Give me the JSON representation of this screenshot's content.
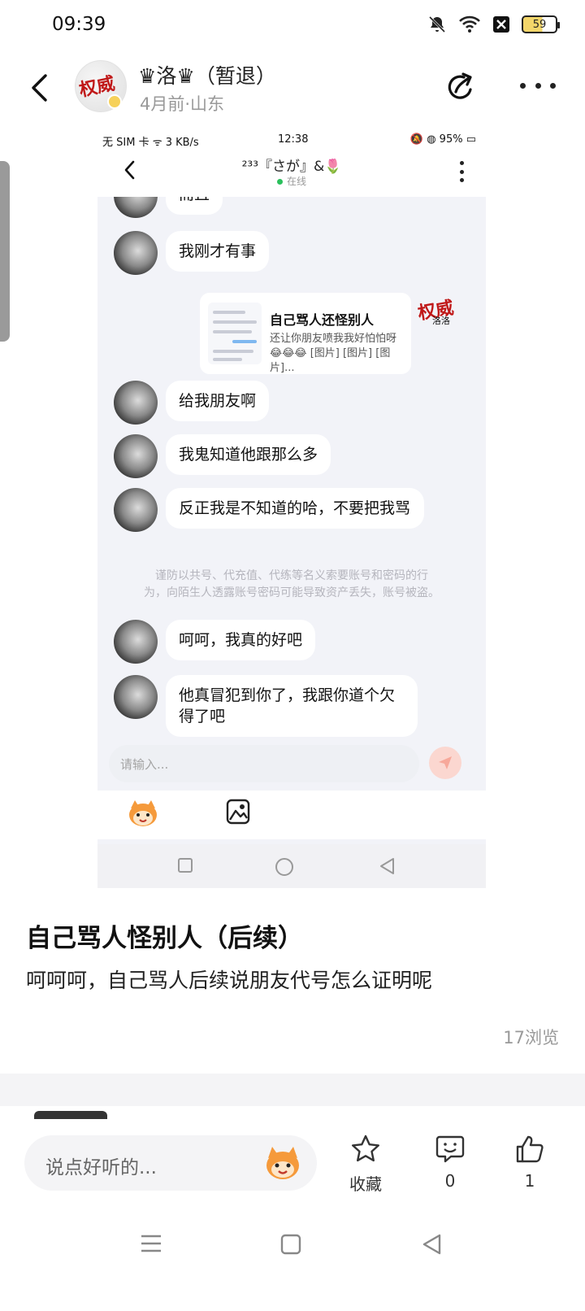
{
  "status_bar": {
    "time": "09:39",
    "battery": "59"
  },
  "post_header": {
    "author_name": "♛洛♛（暂退）",
    "meta": "4月前·山东",
    "avatar_text": "权威"
  },
  "screenshot": {
    "status_left": "无 SIM 卡 ᯤ 3 KB/s",
    "status_time": "12:38",
    "status_right": "🔕 ◍ 95% ▭",
    "chat_title": "²³³『さが』&🌷",
    "chat_status": "在线",
    "messages": [
      {
        "text": "而且"
      },
      {
        "text": "我刚才有事"
      },
      {
        "text": "给我朋友啊"
      },
      {
        "text": "我鬼知道他跟那么多"
      },
      {
        "text": "反正我是不知道的哈，不要把我骂"
      },
      {
        "text": "呵呵，我真的好吧"
      },
      {
        "text": "他真冒犯到你了，我跟你道个欠得了吧"
      }
    ],
    "shared_card": {
      "title": "自己骂人还怪别人",
      "desc": "还让你朋友喷我我好怕怕呀😂😂😂 [图片] [图片] [图片]..."
    },
    "card_avatar": {
      "big": "权威",
      "small": "洛洛"
    },
    "notice_line1": "谨防以共号、代充值、代练等名义索要账号和密码的行",
    "notice_line2": "为，向陌生人透露账号密码可能导致资产丢失，账号被盗。",
    "input_placeholder": "请输入..."
  },
  "post": {
    "title": "自己骂人怪别人（后续）",
    "body": "呵呵呵，自己骂人后续说朋友代号怎么证明呢",
    "views": "17浏览"
  },
  "bottom_bar": {
    "comment_placeholder": "说点好听的...",
    "favorite_label": "收藏",
    "comment_count": "0",
    "like_count": "1"
  },
  "colors": {
    "accent_orange": "#f59a3b",
    "online_green": "#2bc05c",
    "stamp_red": "#c01818"
  }
}
